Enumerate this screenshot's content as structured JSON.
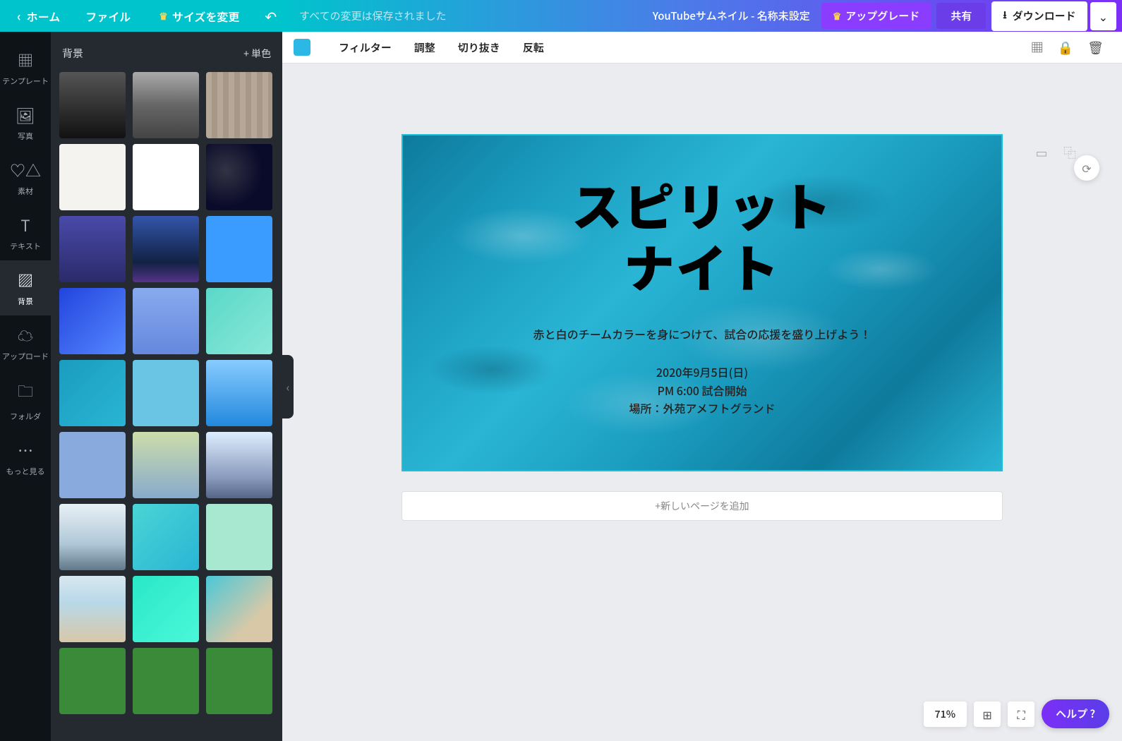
{
  "header": {
    "home": "ホーム",
    "file": "ファイル",
    "resize": "サイズを変更",
    "save_status": "すべての変更は保存されました",
    "doc_title": "YouTubeサムネイル - 名称未設定",
    "upgrade": "アップグレード",
    "share": "共有",
    "download": "ダウンロード"
  },
  "rail": {
    "templates": "テンプレート",
    "photos": "写真",
    "elements": "素材",
    "text": "テキスト",
    "background": "背景",
    "uploads": "アップロード",
    "folders": "フォルダ",
    "more": "もっと見る"
  },
  "panel": {
    "title": "背景",
    "single_color": "+ 単色"
  },
  "toolbar": {
    "filter": "フィルター",
    "adjust": "調整",
    "crop": "切り抜き",
    "flip": "反転"
  },
  "canvas": {
    "title_line1": "スピリット",
    "title_line2": "ナイト",
    "subtitle": "赤と白のチームカラーを身につけて、試合の応援を盛り上げよう！",
    "detail1": "2020年9月5日(日)",
    "detail2": "PM 6:00 試合開始",
    "detail3": "場所：外苑アメフトグランド",
    "add_page": "+新しいページを追加"
  },
  "bottom": {
    "zoom": "71%",
    "help": "ヘルプ ?"
  }
}
